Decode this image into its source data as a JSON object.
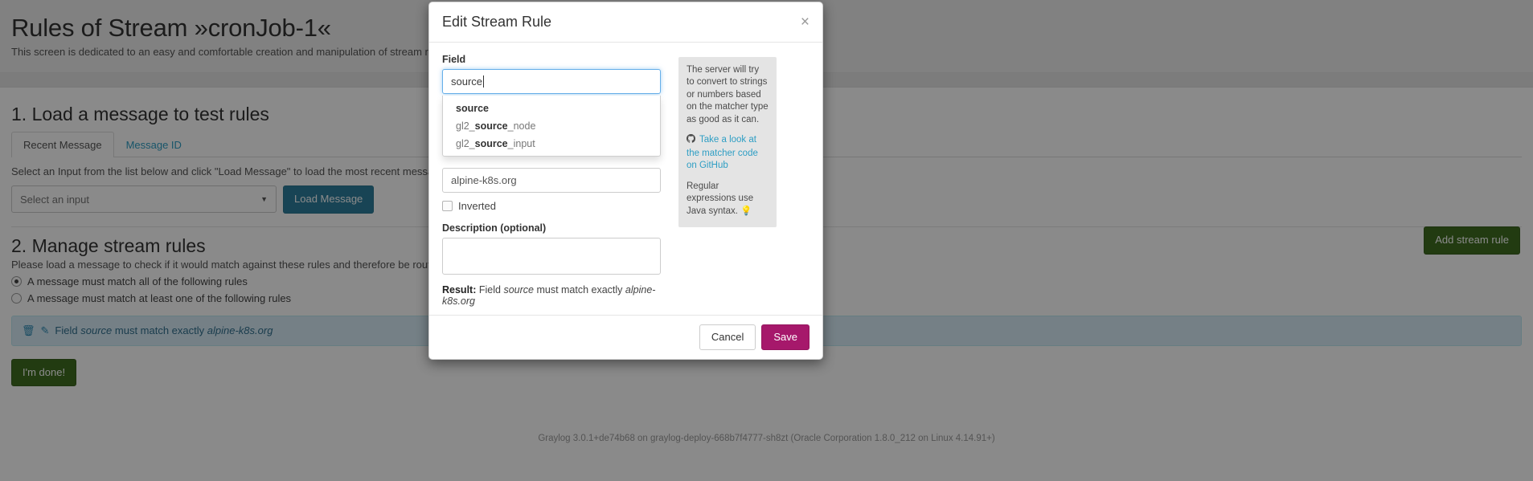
{
  "page": {
    "title": "Rules of Stream »cronJob-1«",
    "description": "This screen is dedicated to an easy and comfortable creation and manipulation of stream rules. You can see the e",
    "footer": "Graylog 3.0.1+de74b68 on graylog-deploy-668b7f4777-sh8zt (Oracle Corporation 1.8.0_212 on Linux 4.14.91+)"
  },
  "section1": {
    "title": "1. Load a message to test rules",
    "tabs": [
      {
        "label": "Recent Message",
        "active": true
      },
      {
        "label": "Message ID",
        "active": false
      }
    ],
    "helper": "Select an Input from the list below and click \"Load Message\" to load the most recent message received by this inp",
    "input_select_value": "Select an input",
    "load_message_label": "Load Message"
  },
  "section2": {
    "title": "2. Manage stream rules",
    "helper": "Please load a message to check if it would match against these rules and therefore be routed into this stream.",
    "add_stream_rule_label": "Add stream rule",
    "match_options": [
      {
        "label": "A message must match all of the following rules",
        "selected": true
      },
      {
        "label": "A message must match at least one of the following rules",
        "selected": false
      }
    ],
    "rules": [
      {
        "prefix": "Field",
        "field": "source",
        "middle": "must match exactly",
        "value": "alpine-k8s.org",
        "delete_icon": "trash-icon",
        "edit_icon": "edit-icon"
      }
    ],
    "done_label": "I'm done!"
  },
  "modal": {
    "title": "Edit Stream Rule",
    "close_label": "×",
    "field_label": "Field",
    "field_value": "source",
    "typeahead": [
      {
        "pre": "",
        "bold": "source",
        "post": ""
      },
      {
        "pre": "gl2_",
        "bold": "source",
        "post": "_node"
      },
      {
        "pre": "gl2_",
        "bold": "source",
        "post": "_input"
      }
    ],
    "value_input": "alpine-k8s.org",
    "inverted_label": "Inverted",
    "inverted_checked": false,
    "description_label": "Description (optional)",
    "description_value": "",
    "result_prefix": "Result:",
    "result_text_1": "Field",
    "result_field": "source",
    "result_text_2": "must match exactly",
    "result_value": "alpine-k8s.org",
    "help": {
      "paragraph_1": "The server will try to convert to strings or numbers based on the matcher type as good as it can.",
      "link_text": "Take a look at the matcher code on GitHub",
      "paragraph_2": "Regular expressions use Java syntax.",
      "bulb_icon": "lightbulb-icon",
      "github_icon": "github-icon"
    },
    "cancel_label": "Cancel",
    "save_label": "Save"
  },
  "colors": {
    "save_button": "#a6186b",
    "success_button": "#3f6e21",
    "info_button": "#2e7f9e",
    "link": "#2e9ec4",
    "rule_row_bg": "#d9edf7"
  }
}
